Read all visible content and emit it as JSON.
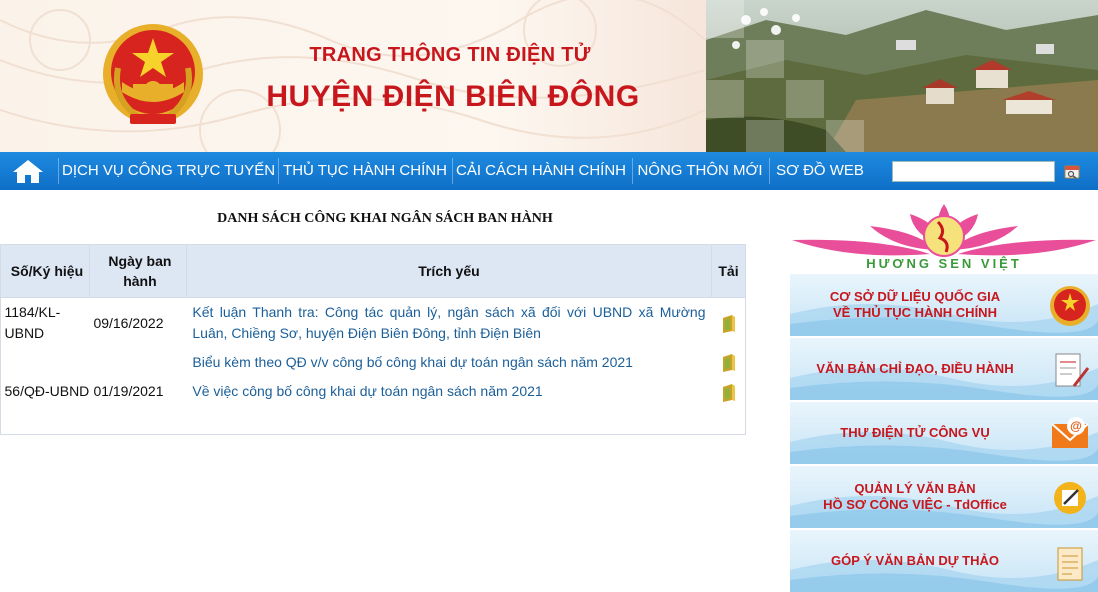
{
  "header": {
    "title_small": "TRANG THÔNG TIN ĐIỆN TỬ",
    "title_big": "HUYỆN ĐIỆN BIÊN ĐÔNG"
  },
  "nav": {
    "items": [
      {
        "label": "DỊCH VỤ CÔNG TRỰC TUYẾN"
      },
      {
        "label": "THỦ TỤC HÀNH CHÍNH"
      },
      {
        "label": "CẢI CÁCH HÀNH CHÍNH"
      },
      {
        "label": "NÔNG THÔN MỚI"
      },
      {
        "label": "SƠ ĐỒ WEB"
      }
    ],
    "search_value": ""
  },
  "main": {
    "heading": "DANH SÁCH CÔNG KHAI NGÂN SÁCH BAN HÀNH",
    "columns": {
      "number": "Số/Ký hiệu",
      "date": "Ngày ban hành",
      "summary": "Trích yếu",
      "download": "Tải"
    },
    "rows": [
      {
        "number": "1184/KL-UBND",
        "date": "09/16/2022",
        "summary": "Kết luận Thanh tra: Công tác quản lý, ngân sách xã đối với UBND xã Mường Luân, Chiềng Sơ, huyện Điện Biên Đông, tỉnh Điện Biên"
      },
      {
        "number": "",
        "date": "",
        "summary": "Biểu kèm theo QĐ v/v công bố công khai dự toán ngân sách năm 2021"
      },
      {
        "number": "56/QĐ-UBND",
        "date": "01/19/2021",
        "summary": "Về việc công bố công khai dự toán ngân sách năm 2021"
      }
    ]
  },
  "sidebar": {
    "logo_text": "HƯƠNG SEN VIỆT",
    "banners": [
      {
        "line1": "CƠ SỞ DỮ LIỆU QUỐC GIA",
        "line2": "VỀ THỦ TỤC HÀNH CHÍNH",
        "icon": "emblem-icon"
      },
      {
        "line1": "VĂN BẢN CHỈ ĐẠO, ĐIỀU HÀNH",
        "line2": "",
        "icon": "document-pen-icon"
      },
      {
        "line1": "THƯ ĐIỆN TỬ CÔNG VỤ",
        "line2": "",
        "icon": "email-icon"
      },
      {
        "line1": "QUẢN LÝ VĂN BẢN",
        "line2": "HỒ SƠ CÔNG VIỆC - TdOffice",
        "icon": "edit-note-icon"
      },
      {
        "line1": "GÓP Ý VĂN BẢN DỰ THẢO",
        "line2": "",
        "icon": "draft-document-icon"
      }
    ]
  },
  "colors": {
    "brand_red": "#c8161d",
    "nav_blue": "#1478d2",
    "link_blue": "#1b5f99"
  }
}
